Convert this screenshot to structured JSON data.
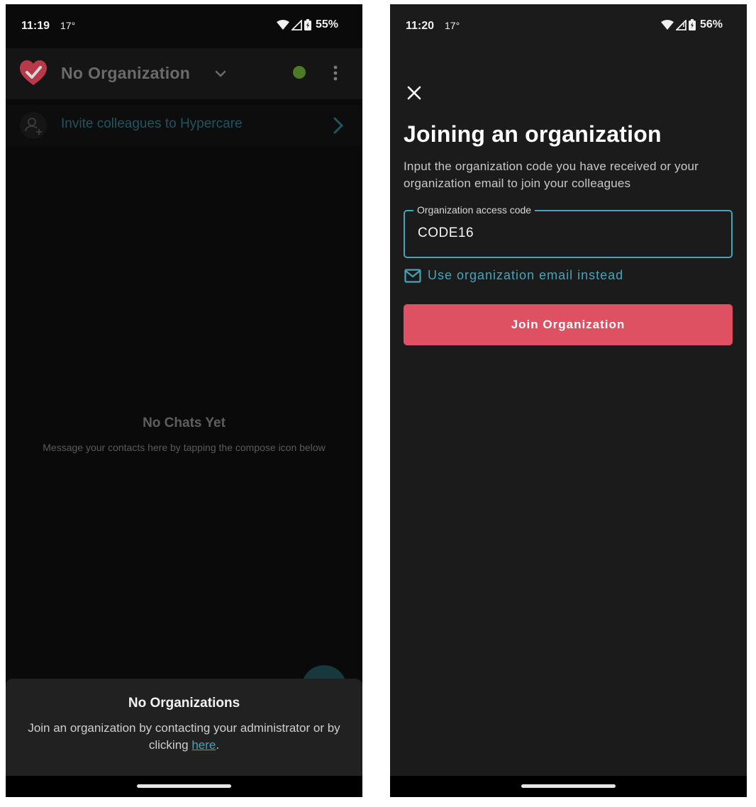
{
  "left_screen": {
    "status_bar": {
      "time": "11:19",
      "temperature": "17°",
      "battery": "55%"
    },
    "app_bar": {
      "org_title": "No Organization"
    },
    "invite_banner": {
      "label": "Invite colleagues to Hypercare"
    },
    "empty_state": {
      "title": "No Chats Yet",
      "message": "Message your contacts here by tapping the compose icon below"
    },
    "bottom_sheet": {
      "title": "No Organizations",
      "message_before_link": "Join an organization by contacting your administrator or by clicking ",
      "link_text": "here",
      "message_after_link": "."
    }
  },
  "right_screen": {
    "status_bar": {
      "time": "11:20",
      "temperature": "17°",
      "battery": "56%"
    },
    "title": "Joining an organization",
    "subtitle": "Input the organization code you have received or your organization email to join your colleagues",
    "access_code_field": {
      "label": "Organization access code",
      "value": "CODE16"
    },
    "email_option": {
      "label": "Use organization email instead"
    },
    "join_button": {
      "label": "Join Organization"
    }
  },
  "colors": {
    "accent_teal": "#4aa3b5",
    "join_button_red": "#dd5162",
    "online_green": "#4c7a25",
    "logo_red": "#c63a4c"
  },
  "icons": [
    "heart-check-logo-icon",
    "chevron-down-icon",
    "status-dot-icon",
    "more-vert-icon",
    "add-person-icon",
    "chevron-right-icon",
    "close-icon",
    "mail-icon",
    "wifi-icon",
    "signal-icon",
    "battery-icon"
  ]
}
